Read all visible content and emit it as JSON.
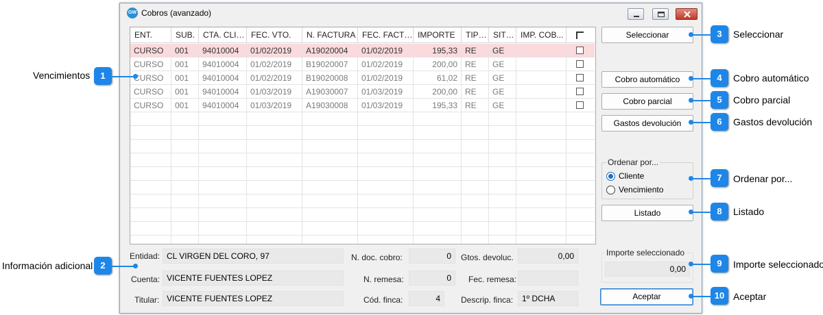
{
  "window": {
    "title": "Cobros (avanzado)",
    "icon": "gw-app-icon"
  },
  "grid": {
    "columns": [
      "ENT.",
      "SUB.",
      "CTA. CLIE...",
      "FEC. VTO.",
      "N. FACTURA",
      "FEC. FACTU...",
      "IMPORTE",
      "TIPO...",
      "SITU...",
      "IMP. COB..."
    ],
    "rows": [
      [
        "CURSO",
        "001",
        "94010004",
        "01/02/2019",
        "A19020004",
        "01/02/2019",
        "195,33",
        "RE",
        "GE",
        ""
      ],
      [
        "CURSO",
        "001",
        "94010004",
        "01/02/2019",
        "B19020007",
        "01/02/2019",
        "200,00",
        "RE",
        "GE",
        ""
      ],
      [
        "CURSO",
        "001",
        "94010004",
        "01/02/2019",
        "B19020008",
        "01/02/2019",
        "61,02",
        "RE",
        "GE",
        ""
      ],
      [
        "CURSO",
        "001",
        "94010004",
        "01/03/2019",
        "A19030007",
        "01/03/2019",
        "200,00",
        "RE",
        "GE",
        ""
      ],
      [
        "CURSO",
        "001",
        "94010004",
        "01/03/2019",
        "A19030008",
        "01/03/2019",
        "195,33",
        "RE",
        "GE",
        ""
      ]
    ]
  },
  "info": {
    "entidad_label": "Entidad:",
    "entidad_value": "CL VIRGEN DEL CORO, 97",
    "cuenta_label": "Cuenta:",
    "cuenta_value": "VICENTE FUENTES LOPEZ",
    "titular_label": "Titular:",
    "titular_value": "VICENTE FUENTES LOPEZ",
    "ndoc_label": "N. doc. cobro:",
    "ndoc_value": "0",
    "nremesa_label": "N. remesa:",
    "nremesa_value": "0",
    "codfinca_label": "Cód. finca:",
    "codfinca_value": "4",
    "gtos_label": "Gtos. devoluc.",
    "gtos_value": "0,00",
    "fecremesa_label": "Fec. remesa:",
    "fecremesa_value": "",
    "descrip_label": "Descrip. finca:",
    "descrip_value": "1º DCHA"
  },
  "buttons": {
    "seleccionar": "Seleccionar",
    "cobro_automatico": "Cobro automático",
    "cobro_parcial": "Cobro parcial",
    "gastos_devolucion": "Gastos devolución",
    "listado": "Listado",
    "aceptar": "Aceptar"
  },
  "ordenar": {
    "title": "Ordenar por...",
    "option1": "Cliente",
    "option2": "Vencimiento",
    "selected": "Cliente"
  },
  "importe": {
    "title": "Importe seleccionado",
    "value": "0,00"
  },
  "callouts": {
    "c1": {
      "number": "1",
      "text": "Vencimientos"
    },
    "c2": {
      "number": "2",
      "text": "Información adicional"
    },
    "c3": {
      "number": "3",
      "text": "Seleccionar"
    },
    "c4": {
      "number": "4",
      "text": "Cobro automático"
    },
    "c5": {
      "number": "5",
      "text": "Cobro parcial"
    },
    "c6": {
      "number": "6",
      "text": "Gastos devolución"
    },
    "c7": {
      "number": "7",
      "text": "Ordenar por..."
    },
    "c8": {
      "number": "8",
      "text": "Listado"
    },
    "c9": {
      "number": "9",
      "text": "Importe seleccionado"
    },
    "c10": {
      "number": "10",
      "text": "Aceptar"
    }
  },
  "colors": {
    "accent": "#1e86e8",
    "selected_row": "#fadadd"
  }
}
